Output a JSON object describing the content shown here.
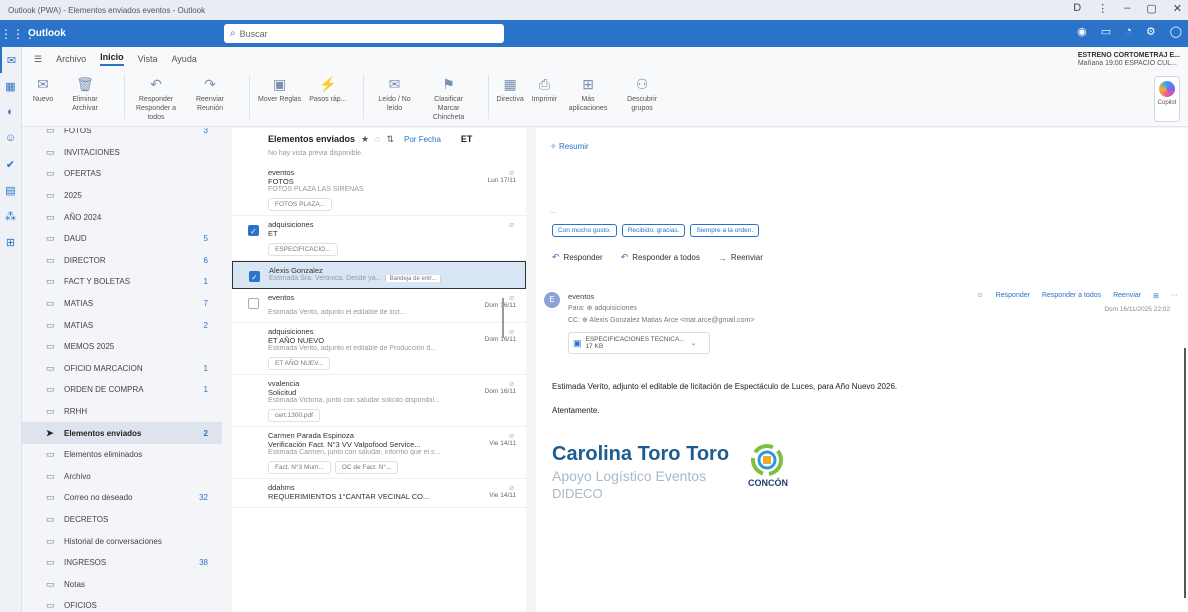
{
  "window": {
    "title": "Outlook (PWA) - Elementos enviados eventos - Outlook",
    "controls": [
      "D",
      "⋮",
      "–",
      "▢",
      "✕"
    ]
  },
  "header": {
    "app_name": "Outlook",
    "search_placeholder": "Buscar"
  },
  "notification": {
    "title": "ESTRENO CORTOMETRAJ E...",
    "detail": "Mañana 19:00 ESPACIO CUL..."
  },
  "ribbon_tabs": [
    "Archivo",
    "Inicio",
    "Vista",
    "Ayuda"
  ],
  "ribbon": {
    "groups": [
      {
        "label": "Nuevo",
        "icon": "✉"
      },
      {
        "label": "Eliminar Archivar",
        "icon": "🗑"
      },
      {
        "label": "Responder Responder a todos",
        "icon": "↶"
      },
      {
        "label": "Reenviar Reunión",
        "icon": "↷"
      },
      {
        "label": "Mover Reglas",
        "icon": "▣"
      },
      {
        "label": "Pasos ráp...",
        "icon": "⚡"
      },
      {
        "label": "Leído / No leído",
        "icon": "✉"
      },
      {
        "label": "Clasificar Marcar Chincheta",
        "icon": "⚑"
      },
      {
        "label": "Directiva",
        "icon": "▦"
      },
      {
        "label": "Imprimir",
        "icon": "⎙"
      },
      {
        "label": "Más aplicaciones",
        "icon": "⊞"
      },
      {
        "label": "Descubrir grupos",
        "icon": "⚇"
      }
    ],
    "copilot": "Copilot"
  },
  "folders": [
    {
      "name": "FOTOS",
      "count": "3"
    },
    {
      "name": "INVITACIONES",
      "count": ""
    },
    {
      "name": "OFERTAS",
      "count": ""
    },
    {
      "name": "2025",
      "count": ""
    },
    {
      "name": "AÑO 2024",
      "count": ""
    },
    {
      "name": "DAUD",
      "count": "5"
    },
    {
      "name": "DIRECTOR",
      "count": "6"
    },
    {
      "name": "FACT Y BOLETAS",
      "count": "1"
    },
    {
      "name": "MATIAS",
      "count": "7"
    },
    {
      "name": "MATIAS",
      "count": "2"
    },
    {
      "name": "MEMOS 2025",
      "count": ""
    },
    {
      "name": "OFICIO MARCACION",
      "count": "1"
    },
    {
      "name": "ORDEN DE COMPRA",
      "count": "1"
    },
    {
      "name": "RRHH",
      "count": ""
    },
    {
      "name": "Elementos enviados",
      "count": "2",
      "selected": true
    },
    {
      "name": "Elementos eliminados",
      "count": ""
    },
    {
      "name": "Archivo",
      "count": ""
    },
    {
      "name": "Correo no deseado",
      "count": "32"
    },
    {
      "name": "DECRETOS",
      "count": ""
    },
    {
      "name": "Historial de conversaciones",
      "count": ""
    },
    {
      "name": "INGRESOS",
      "count": "38"
    },
    {
      "name": "Notas",
      "count": ""
    },
    {
      "name": "OFICIOS",
      "count": ""
    }
  ],
  "message_list": {
    "title": "Elementos enviados",
    "sort": "Por Fecha",
    "filter": "ET",
    "no_preview": "No hay vista previa disponible.",
    "messages": [
      {
        "from": "eventos",
        "subject": "FOTOS",
        "date": "Lun 17/11",
        "preview": "FOTOS PLAZA LAS SIRENAS",
        "attachments": [
          "FOTOS PLAZA..."
        ]
      },
      {
        "from": "adquisiciones",
        "subject": "ET",
        "date": "",
        "preview": "",
        "attachments": [
          "ESPECIFICACIO..."
        ]
      },
      {
        "from": "Alexis Gonzalez",
        "subject": "",
        "date": "",
        "preview": "Estimada Sra. Verónica. Desde ya...",
        "tag": "Bandeja de entr...",
        "highlighted": true
      },
      {
        "from": "eventos",
        "subject": "",
        "date": "Dom 16/11",
        "preview": "Estimada Verito, adjunto el editable de licit..."
      },
      {
        "from": "adquisiciones",
        "subject": "ET AÑO NUEVO",
        "date": "Dom 16/11",
        "preview": "Estimada Verito, adjunto el editable de Producción d...",
        "attachments": [
          "ET AÑO NUEV..."
        ]
      },
      {
        "from": "vvalencia",
        "subject": "Solicitud",
        "date": "Dom 16/11",
        "preview": "Estimada Victoria, junto con saludar solicito disponibil...",
        "attachments": [
          "cert.1300.pdf"
        ]
      },
      {
        "from": "Carmen Parada Espinoza",
        "subject": "Verificación Fact. N°3 VV Valpofood Service...",
        "date": "Vie 14/11",
        "preview": "Estimada Carmen, junto con saludar, informo que el s...",
        "attachments": [
          "Fact. N°3 Mum...",
          "OC de Fact. N°..."
        ]
      },
      {
        "from": "ddahms",
        "subject": "REQUERIMIENTOS 1°CANTAR VECINAL CO...",
        "date": "Vie 14/11",
        "preview": ""
      }
    ]
  },
  "reading": {
    "summary_label": "Resumir",
    "prev_dots": "...",
    "quick_replies": [
      "Con mucho gusto.",
      "Recibido, gracias.",
      "Siempre a la orden."
    ],
    "actions": [
      "Responder",
      "Responder a todos",
      "Reenviar"
    ],
    "email": {
      "avatar": "E",
      "from": "eventos",
      "to": "Para: ⊕ adquisiciones",
      "cc": "CC: ⊕ Alexis Gonzalez   Matias Arce <mat.arce@gmail.com>",
      "date": "Dom 16/11/2025 22:02",
      "actions": [
        "Responder",
        "Responder a todos",
        "Reenviar"
      ],
      "attachment": "ESPECIFICACIONES TECNICA...",
      "attachment_size": "17 KB",
      "body": "Estimada Verito, adjunto el editable de licitación de Espectáculo de Luces, para Año Nuevo 2026.",
      "closing": "Atentamente.",
      "signature_name": "Carolina Toro Toro",
      "signature_role": "Apoyo Logístico Eventos",
      "signature_dept": "DIDECO",
      "signature_logo": "CONCÓN"
    }
  },
  "colors": {
    "accent": "#2a73c9",
    "signature": "#1f5c8f"
  }
}
